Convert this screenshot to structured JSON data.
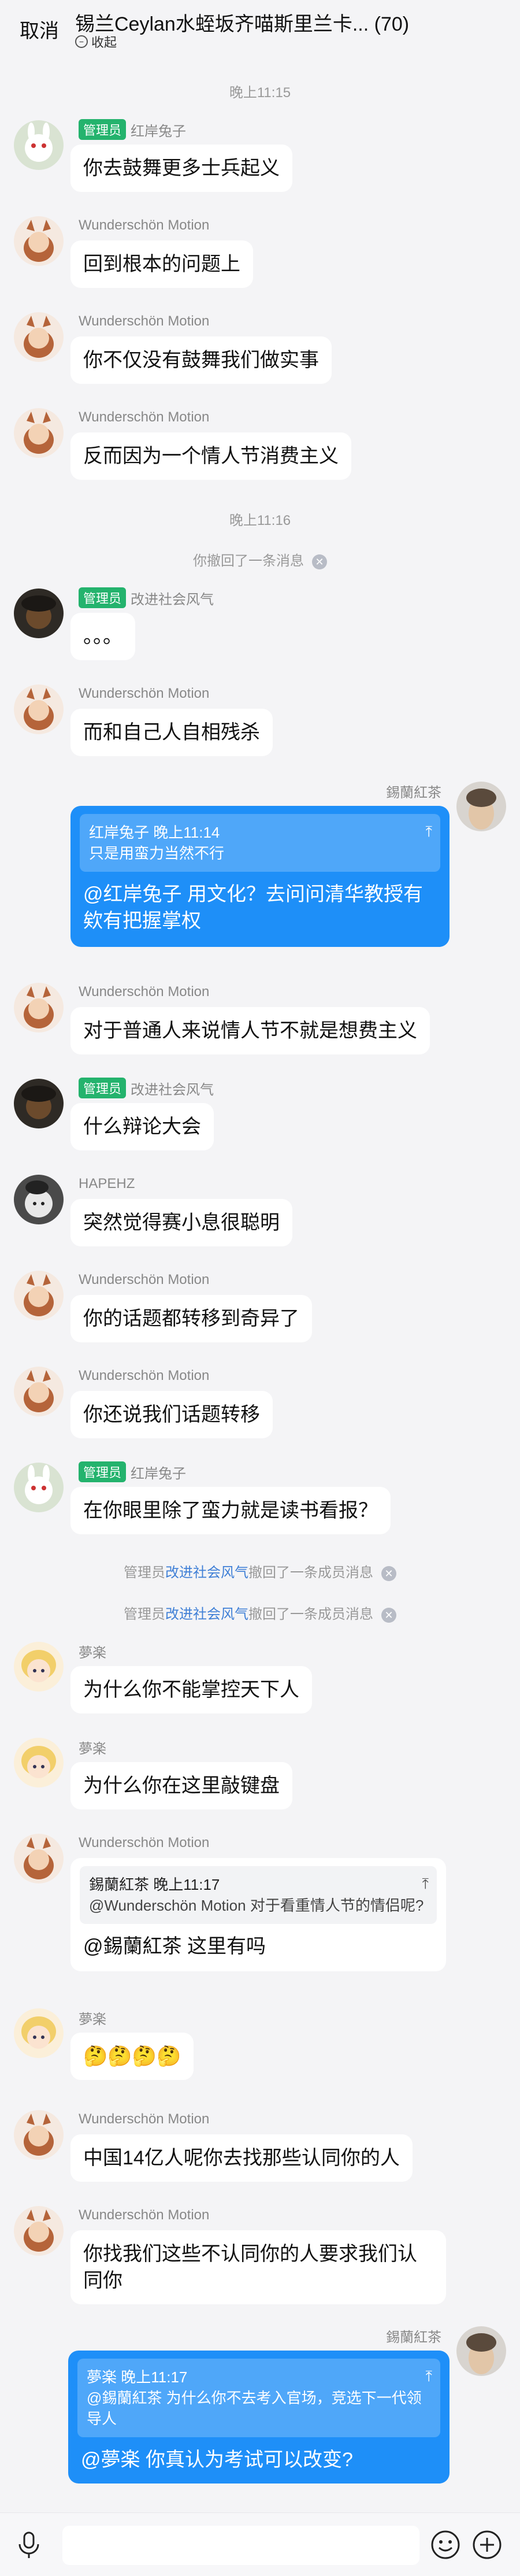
{
  "header": {
    "cancel": "取消",
    "title": "锡兰Ceylan水蛭坂齐喵斯里兰卡... (70)",
    "collapse": "收起"
  },
  "timestamps": [
    "晚上11:15",
    "晚上11:16"
  ],
  "system": {
    "recall_self": "你撤回了一条消息",
    "admin_prefix": "管理员",
    "admin_name": "改进社会风气",
    "recall_member": "撤回了一条成员消息"
  },
  "badge": "管理员",
  "messages": [
    {
      "name": "红岸兔子",
      "admin": true,
      "text": "你去鼓舞更多士兵起义"
    },
    {
      "name": "Wunderschön Motion",
      "text": "回到根本的问题上"
    },
    {
      "name": "Wunderschön Motion",
      "text": "你不仅没有鼓舞我们做实事"
    },
    {
      "name": "Wunderschön Motion",
      "text": "反而因为一个情人节消费主义"
    },
    {
      "name": "改进社会风气",
      "admin": true,
      "text": "。。。"
    },
    {
      "name": "Wunderschön Motion",
      "text": "而和自己人自相残杀"
    },
    {
      "name": "錫蘭紅茶",
      "self": true,
      "quote_head": "红岸兔子 晚上11:14",
      "quote_text": "只是用蛮力当然不行",
      "text": "@红岸兔子 用文化？去问问清华教授有 欸有把握掌权"
    },
    {
      "name": "Wunderschön Motion",
      "text": "对于普通人来说情人节不就是想费主义"
    },
    {
      "name": "改进社会风气",
      "admin": true,
      "text": "什么辩论大会"
    },
    {
      "name": "HAPEHZ",
      "text": "突然觉得赛小息很聪明"
    },
    {
      "name": "Wunderschön Motion",
      "text": "你的话题都转移到奇异了"
    },
    {
      "name": "Wunderschön Motion",
      "text": "你还说我们话题转移"
    },
    {
      "name": "红岸兔子",
      "admin": true,
      "text": "在你眼里除了蛮力就是读书看报？"
    },
    {
      "name": "夢楽",
      "text": "为什么你不能掌控天下人"
    },
    {
      "name": "夢楽",
      "text": "为什么你在这里敲键盘"
    },
    {
      "name": "Wunderschön Motion",
      "quote_head": "錫蘭紅茶 晚上11:17",
      "quote_text": "@Wunderschön Motion 对于看重情人节的情侣呢?",
      "text": "@錫蘭紅茶 这里有吗"
    },
    {
      "name": "夢楽",
      "text": "🤔🤔🤔🤔"
    },
    {
      "name": "Wunderschön Motion",
      "text": "中国14亿人呢你去找那些认同你的人"
    },
    {
      "name": "Wunderschön Motion",
      "text": "你找我们这些不认同你的人要求我们认 同你"
    },
    {
      "name": "錫蘭紅茶",
      "self": true,
      "quote_head": "夢楽 晚上11:17",
      "quote_text": "@錫蘭紅茶 为什么你不去考入官场，竞选下一代领导人",
      "text": "@夢楽 你真认为考试可以改变?"
    }
  ],
  "colors": {
    "accent": "#1e8ff8",
    "admin_badge": "#24b36d",
    "link": "#3f7fd6"
  }
}
